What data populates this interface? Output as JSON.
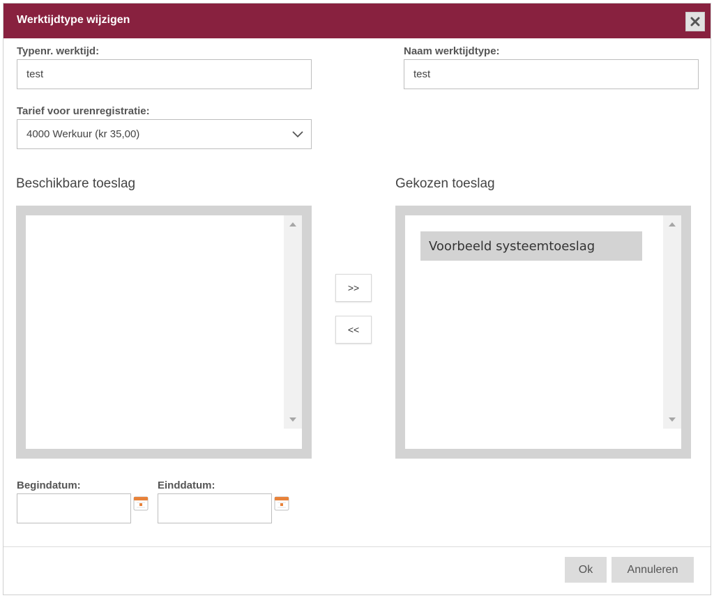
{
  "dialog": {
    "title": "Werktijdtype wijzigen",
    "close_icon": "close-icon",
    "accent_color": "#88213f"
  },
  "form": {
    "typenr_label": "Typenr. werktijd:",
    "typenr_value": "test",
    "naam_label": "Naam werktijdtype:",
    "naam_value": "test",
    "tarief_label": "Tarief voor urenregistratie:",
    "tarief_selected": "4000 Werkuur (kr 35,00)"
  },
  "lists": {
    "available_title": "Beschikbare toeslag",
    "available_items": [],
    "chosen_title": "Gekozen toeslag",
    "chosen_items": [
      "Voorbeeld systeemtoeslag"
    ],
    "add_button": ">>",
    "remove_button": "<<"
  },
  "dates": {
    "begin_label": "Begindatum:",
    "begin_value": "",
    "eind_label": "Einddatum:",
    "eind_value": "",
    "icon": "calendar-icon"
  },
  "footer": {
    "ok_label": "Ok",
    "cancel_label": "Annuleren"
  }
}
